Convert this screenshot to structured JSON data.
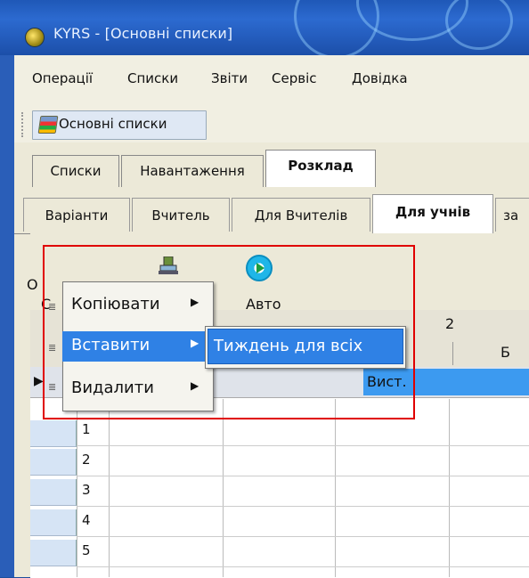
{
  "window": {
    "title": "KYRS - [Основні списки]"
  },
  "menubar": {
    "items": [
      "Операції",
      "Списки",
      "Звіти",
      "Сервіс",
      "Довідка"
    ]
  },
  "toolbar": {
    "button_label": "Основні списки"
  },
  "tabs_top": {
    "items": [
      "Списки",
      "Навантаження",
      "Розклад"
    ],
    "active": "Розклад"
  },
  "tabs_sub": {
    "items": [
      "Варіанти",
      "Вчитель",
      "Для Вчителів",
      "Для учнів",
      "за"
    ],
    "active": "Для учнів"
  },
  "panel": {
    "auto_label": "Авто",
    "left_char": "С",
    "left_char2": "О"
  },
  "grid": {
    "header_col": "2",
    "subheader_col": "Б",
    "selected_row_cell": "Вист.",
    "row_numbers": [
      "1",
      "2",
      "3",
      "4",
      "5"
    ]
  },
  "context_menu": {
    "items": [
      "Копіювати",
      "Вставити",
      "Видалити"
    ],
    "highlighted": "Вставити",
    "submenu": {
      "items": [
        "Тиждень для всіх"
      ]
    }
  },
  "colors": {
    "title_bar": "#2c6ad0",
    "highlight": "#2f81e5",
    "annotation": "#e00000",
    "selection_cell": "#3c9af0"
  }
}
